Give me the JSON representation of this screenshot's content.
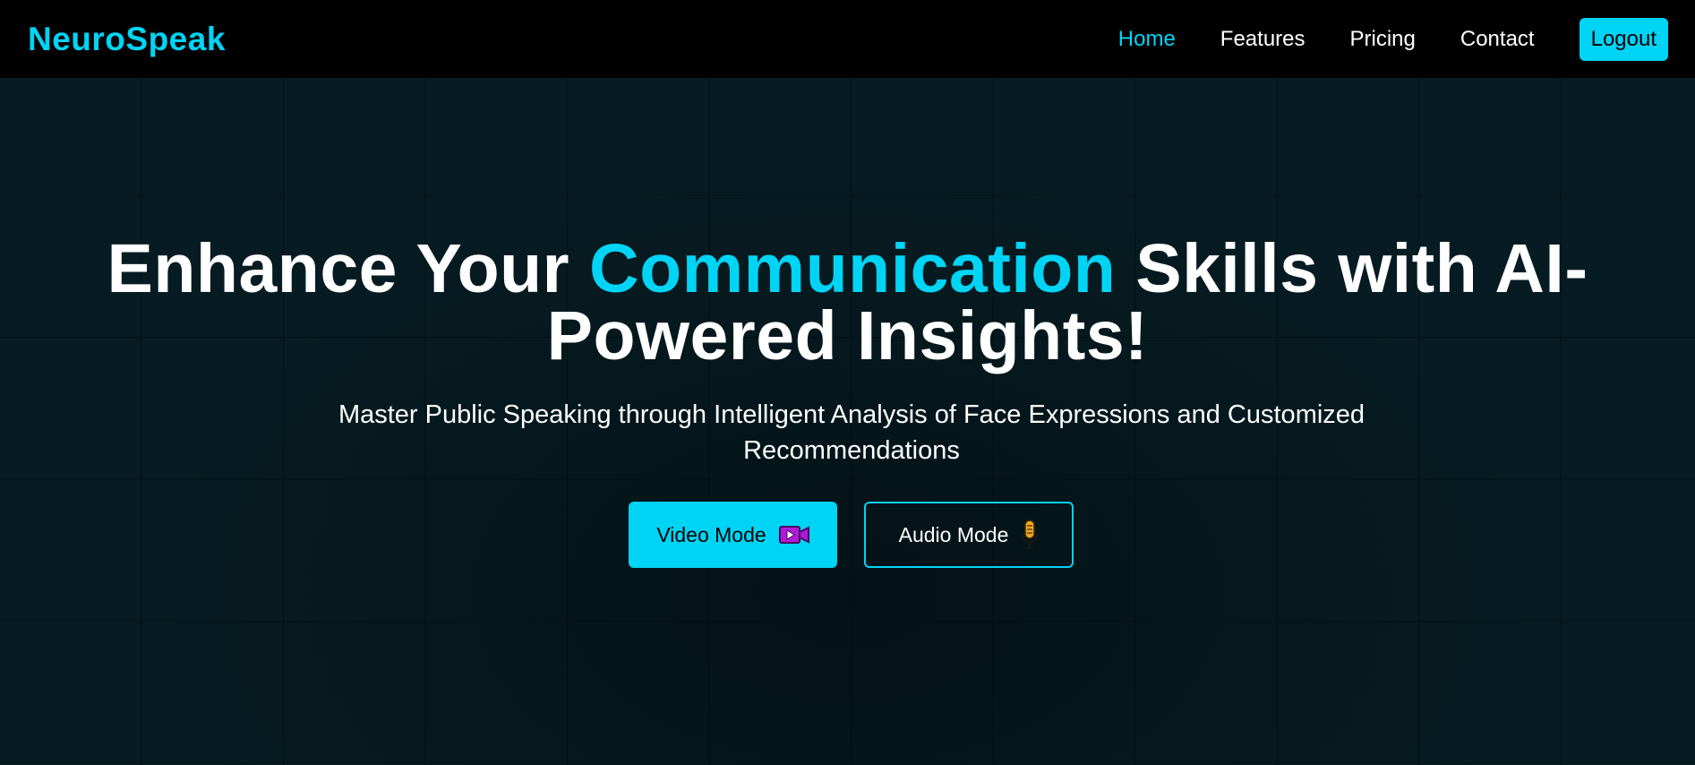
{
  "nav": {
    "brand": "NeuroSpeak",
    "links": [
      {
        "label": "Home",
        "active": true
      },
      {
        "label": "Features",
        "active": false
      },
      {
        "label": "Pricing",
        "active": false
      },
      {
        "label": "Contact",
        "active": false
      }
    ],
    "logout_label": "Logout"
  },
  "hero": {
    "headline_part1": "Enhance Your ",
    "headline_accent": "Communication",
    "headline_part2": " Skills with AI-Powered Insights!",
    "subheadline": "Master Public Speaking through Intelligent Analysis of Face Expressions and Customized Recommendations",
    "buttons": {
      "video": {
        "label": "Video Mode",
        "icon": "video-camera-icon"
      },
      "audio": {
        "label": "Audio Mode",
        "icon": "microphone-icon"
      }
    }
  },
  "colors": {
    "accent": "#00d4f5",
    "navbar_bg": "#000000",
    "hero_bg": "#061c22",
    "text": "#ffffff"
  }
}
